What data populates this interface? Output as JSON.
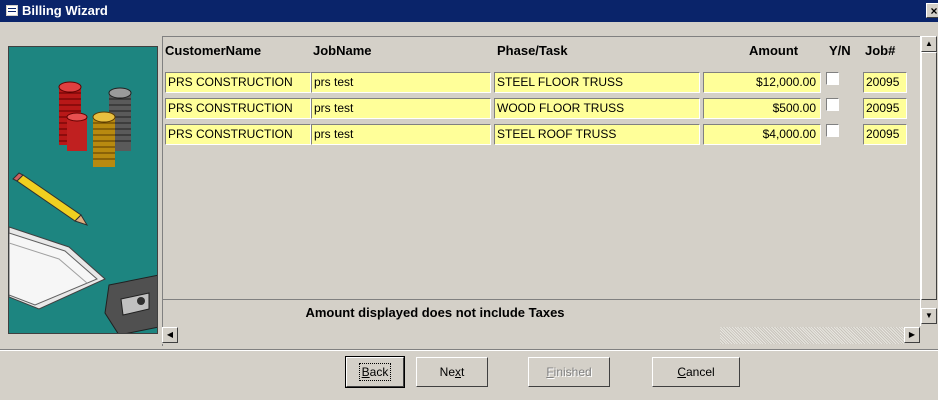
{
  "window": {
    "title": "Billing Wizard",
    "close_label": "×"
  },
  "columns": {
    "customer": "CustomerName",
    "job": "JobName",
    "phase": "Phase/Task",
    "amount": "Amount",
    "yn": "Y/N",
    "jobnum": "Job#"
  },
  "rows": [
    {
      "customer": "PRS CONSTRUCTION",
      "job": "prs test",
      "phase": "STEEL FLOOR TRUSS",
      "amount": "$12,000.00",
      "yn": false,
      "jobnum": "20095"
    },
    {
      "customer": "PRS CONSTRUCTION",
      "job": "prs test",
      "phase": "WOOD FLOOR TRUSS",
      "amount": "$500.00",
      "yn": false,
      "jobnum": "20095"
    },
    {
      "customer": "PRS CONSTRUCTION",
      "job": "prs test",
      "phase": "STEEL ROOF TRUSS",
      "amount": "$4,000.00",
      "yn": false,
      "jobnum": "20095"
    }
  ],
  "note": "Amount displayed does not include Taxes",
  "buttons": {
    "back": {
      "pre": "",
      "key": "B",
      "post": "ack"
    },
    "next": {
      "pre": "Ne",
      "key": "x",
      "post": "t"
    },
    "finished": {
      "pre": "",
      "key": "F",
      "post": "inished"
    },
    "cancel": {
      "pre": "",
      "key": "C",
      "post": "ancel"
    }
  },
  "icons": {
    "window_icon": "form-icon",
    "close": "close-icon",
    "scroll_left": "arrow-left-icon",
    "scroll_right": "arrow-right-icon",
    "scroll_up": "arrow-up-icon",
    "scroll_down": "arrow-down-icon"
  },
  "colors": {
    "titlebar": "#0a246a",
    "field_bg": "#ffff99",
    "art_bg": "#1d8580",
    "face": "#d4d0c8"
  }
}
